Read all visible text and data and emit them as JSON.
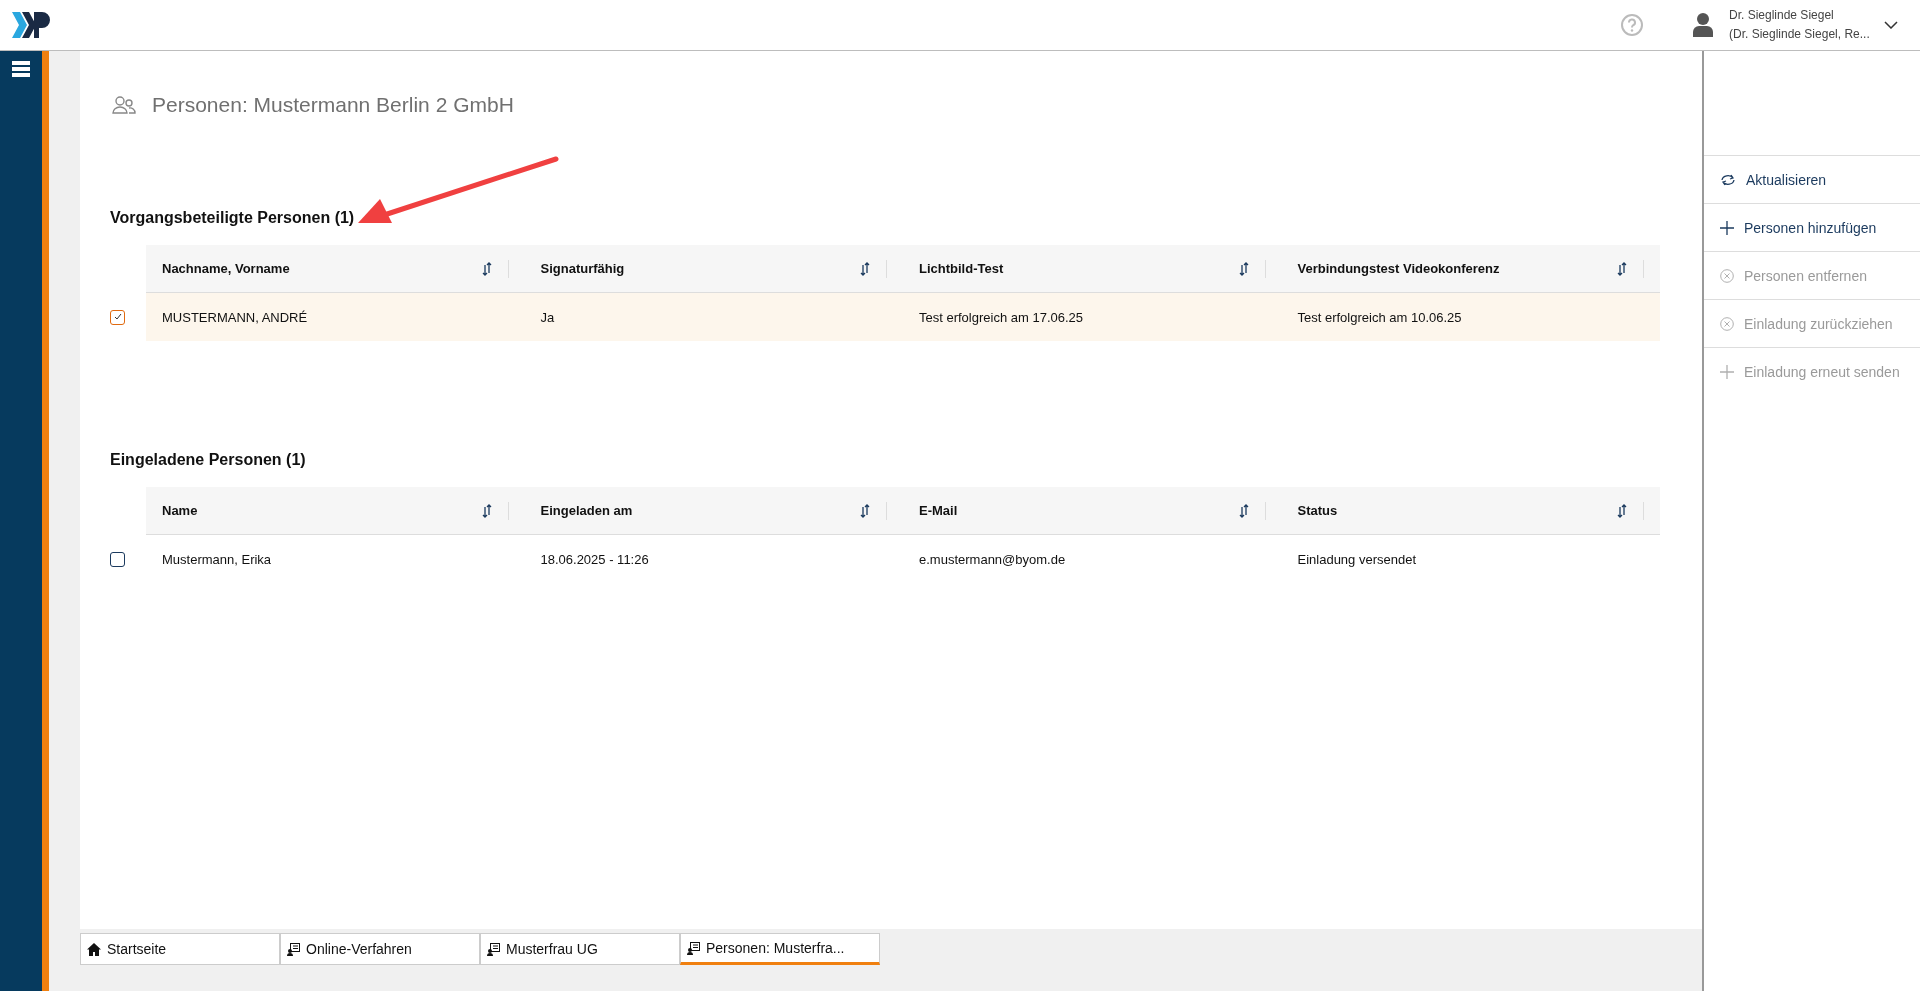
{
  "user": {
    "name": "Dr. Sieglinde Siegel",
    "role": "(Dr. Sieglinde Siegel, Re..."
  },
  "page_title": "Personen: Mustermann Berlin 2 GmbH",
  "sections": [
    {
      "heading": "Vorgangsbeteiligte Personen (1)",
      "columns": [
        "Nachname, Vorname",
        "Signaturfähig",
        "Lichtbild-Test",
        "Verbindungstest Videokonferenz"
      ],
      "rows": [
        {
          "checked": true,
          "cells": [
            "MUSTERMANN, ANDRÉ",
            "Ja",
            "Test erfolgreich am 17.06.25",
            "Test erfolgreich am 10.06.25"
          ]
        }
      ]
    },
    {
      "heading": "Eingeladene Personen (1)",
      "columns": [
        "Name",
        "Eingeladen am",
        "E-Mail",
        "Status"
      ],
      "rows": [
        {
          "checked": false,
          "cells": [
            "Mustermann, Erika",
            "18.06.2025 - 11:26",
            "e.mustermann@byom.de",
            "Einladung versendet"
          ]
        }
      ]
    }
  ],
  "actions": [
    {
      "kind": "refresh",
      "label": "Aktualisieren",
      "disabled": false
    },
    {
      "kind": "add",
      "label": "Personen hinzufügen",
      "disabled": false
    },
    {
      "kind": "remove",
      "label": "Personen entfernen",
      "disabled": true
    },
    {
      "kind": "remove",
      "label": "Einladung zurückziehen",
      "disabled": true
    },
    {
      "kind": "add",
      "label": "Einladung erneut senden",
      "disabled": true
    }
  ],
  "tabs": [
    {
      "kind": "home",
      "label": "Startseite",
      "selected": false
    },
    {
      "kind": "case",
      "label": "Online-Verfahren",
      "selected": false
    },
    {
      "kind": "case",
      "label": "Musterfrau UG",
      "selected": false
    },
    {
      "kind": "case",
      "label": "Personen: Musterfra...",
      "selected": true
    }
  ]
}
